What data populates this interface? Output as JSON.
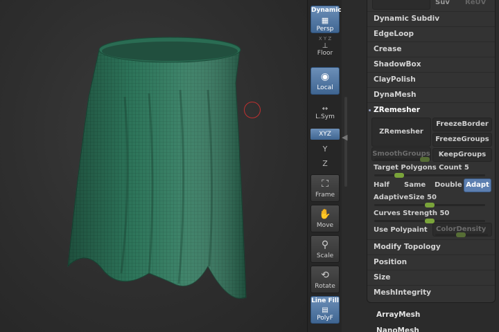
{
  "shelf": {
    "dynamic_label": "Dynamic",
    "persp_label": "Persp",
    "floor_label": "Floor",
    "floor_axes": "X Y Z",
    "local_label": "Local",
    "lsym_label": "L.Sym",
    "xyz_label": "XYZ",
    "rot_y": "Y",
    "rot_z": "Z",
    "frame_label": "Frame",
    "move_label": "Move",
    "scale_label": "Scale",
    "rotate_label": "Rotate",
    "linefill_label": "Line Fill",
    "polyf_label": "PolyF"
  },
  "panel": {
    "suv_label": "Suv",
    "reuv_label": "ReUV",
    "rows": {
      "dynamic_subdiv": "Dynamic Subdiv",
      "edgeloop": "EdgeLoop",
      "crease": "Crease",
      "shadowbox": "ShadowBox",
      "claypolish": "ClayPolish",
      "dynamesh": "DynaMesh",
      "zremesher": "ZRemesher",
      "modify_topology": "Modify Topology",
      "position": "Position",
      "size": "Size",
      "meshintegrity": "MeshIntegrity"
    },
    "zremesher_button": "ZRemesher",
    "freeze_border": "FreezeBorder",
    "freeze_groups": "FreezeGroups",
    "smooth_groups": "SmoothGroups",
    "keep_groups": "KeepGroups",
    "target_polygons": "Target Polygons Count 5",
    "half": "Half",
    "same": "Same",
    "double": "Double",
    "adapt": "Adapt",
    "adaptive_size": "AdaptiveSize 50",
    "curves_strength": "Curves Strength 50",
    "use_polypaint": "Use Polypaint",
    "color_density": "ColorDensity",
    "sliders": {
      "target_polygons": 0.2,
      "adaptive_size": 0.5,
      "curves_strength": 0.5
    }
  },
  "below": {
    "arraymesh": "ArrayMesh",
    "nanomesh": "NanoMesh"
  },
  "colors": {
    "mesh": "#2f7a5e",
    "accent": "#5d7fb0",
    "slider": "#7aa43a"
  }
}
